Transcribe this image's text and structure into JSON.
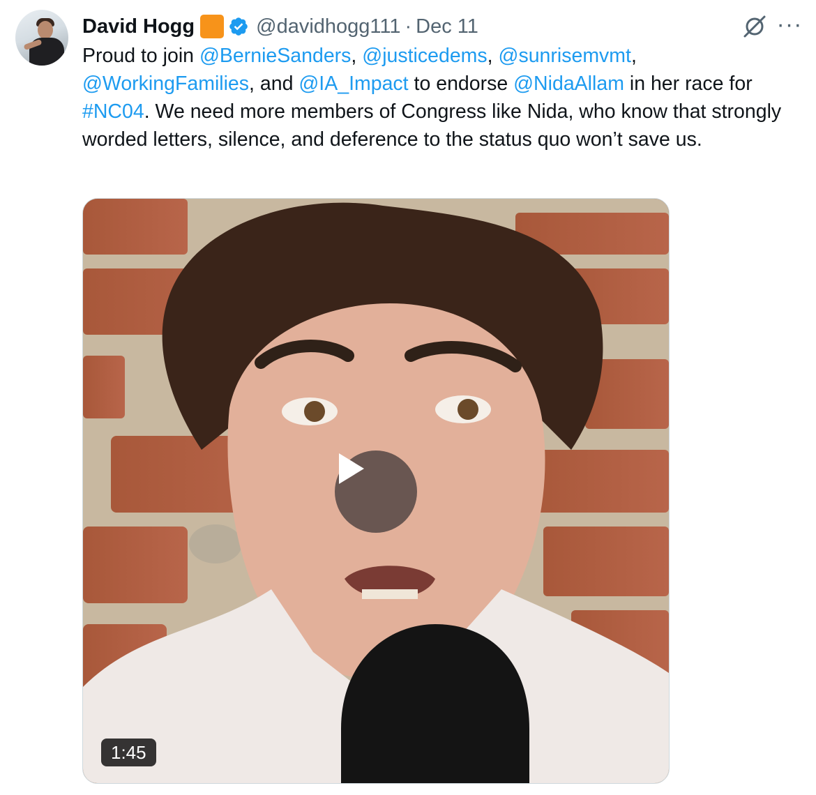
{
  "tweet": {
    "author_name": "David Hogg",
    "handle": "@davidhogg111",
    "separator": "·",
    "date": "Dec 11",
    "text_parts": [
      {
        "t": "Proud to join "
      },
      {
        "t": "@BernieSanders",
        "link": true
      },
      {
        "t": ", "
      },
      {
        "t": "@justicedems",
        "link": true
      },
      {
        "t": ", "
      },
      {
        "t": "@sunrisemvmt",
        "link": true
      },
      {
        "t": ", "
      },
      {
        "t": "@WorkingFamilies",
        "link": true
      },
      {
        "t": ", and "
      },
      {
        "t": "@IA_Impact",
        "link": true
      },
      {
        "t": " to endorse "
      },
      {
        "t": "@NidaAllam",
        "link": true
      },
      {
        "t": " in her race for "
      },
      {
        "t": "#NC04",
        "link": true
      },
      {
        "t": ". We need more members of Congress like Nida, who know that strongly worded letters, silence, and deference to the status quo won’t save us."
      }
    ],
    "video": {
      "duration": "1:45"
    },
    "more_label": "···"
  },
  "colors": {
    "link": "#1d9bf0",
    "secondary_text": "#536471",
    "badge": "#f7931a",
    "verified": "#1d9bf0"
  },
  "icons": {
    "avatar": "profile-photo",
    "verified": "verified-check-icon",
    "grok": "grok-icon",
    "more": "more-icon",
    "play": "play-icon"
  }
}
